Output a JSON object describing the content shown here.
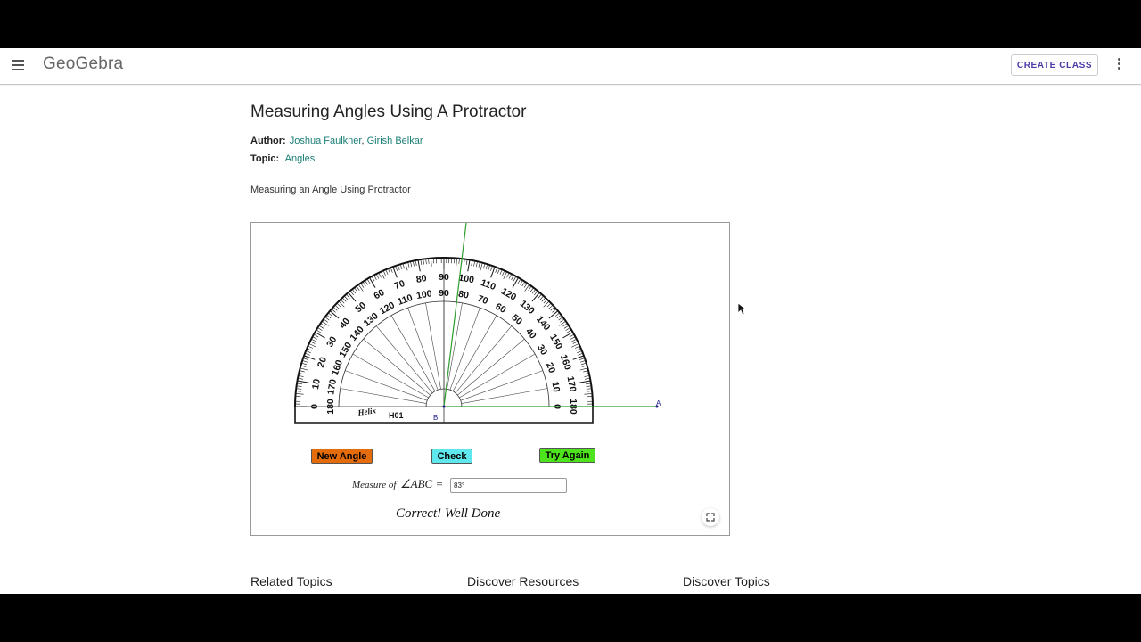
{
  "header": {
    "logo": "GeoGebra",
    "create_class": "CREATE CLASS",
    "menu_icon": "hamburger-menu-icon",
    "more_icon": "more-vertical-icon"
  },
  "article": {
    "title": "Measuring Angles Using A Protractor",
    "author_label": "Author:",
    "authors": [
      "Joshua Faulkner",
      "Girish Belkar"
    ],
    "author_sep": ",",
    "topic_label": "Topic:",
    "topic": "Angles",
    "description": "Measuring an Angle Using Protractor"
  },
  "applet": {
    "protractor": {
      "outer_labels": [
        "0",
        "10",
        "20",
        "30",
        "40",
        "50",
        "60",
        "70",
        "80",
        "90",
        "100",
        "110",
        "120",
        "130",
        "140",
        "150",
        "160",
        "170",
        "180"
      ],
      "inner_labels": [
        "180",
        "170",
        "160",
        "150",
        "140",
        "130",
        "120",
        "110",
        "100",
        "90",
        "80",
        "70",
        "60",
        "50",
        "40",
        "30",
        "20",
        "10",
        "0"
      ],
      "brand": "Helix",
      "model": "H01"
    },
    "point_a": "A",
    "point_b": "B",
    "buttons": {
      "new_angle": "New Angle",
      "check": "Check",
      "try_again": "Try Again"
    },
    "measure_label": "Measure of",
    "measure_angle": "∠ABC =",
    "answer_value": "83°",
    "feedback": "Correct! Well Done",
    "fullscreen_icon": "fullscreen-icon",
    "colors": {
      "ray": "#2e9c2e",
      "new_angle_bg": "#e46c0a",
      "check_bg": "#5ee8ee",
      "try_again_bg": "#4ee41d"
    }
  },
  "footer": {
    "related_topics": "Related Topics",
    "discover_resources": "Discover Resources",
    "discover_topics": "Discover Topics"
  }
}
